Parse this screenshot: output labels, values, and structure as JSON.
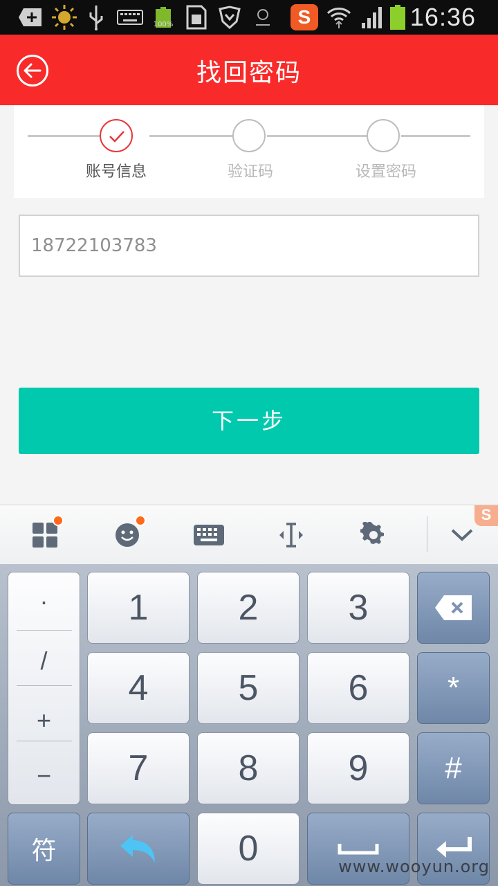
{
  "status_bar": {
    "time": "16:36",
    "battery_text": "100%",
    "sogou_badge": "S",
    "icons": [
      "plus-icon",
      "brightness-icon",
      "usb-icon",
      "keyboard-icon",
      "battery-full-icon",
      "sd-card-icon",
      "shield-icon",
      "emblem-icon",
      "sogou-icon",
      "wifi-icon",
      "signal-icon",
      "battery-icon"
    ]
  },
  "header": {
    "title": "找回密码",
    "background": "#f92a2a"
  },
  "steps": [
    {
      "label": "账号信息",
      "state": "done"
    },
    {
      "label": "验证码",
      "state": "pending"
    },
    {
      "label": "设置密码",
      "state": "pending"
    }
  ],
  "form": {
    "phone_value": "18722103783"
  },
  "next_button": {
    "label": "下一步",
    "color": "#00c9ae"
  },
  "keyboard": {
    "toolbar_icons": [
      "apps-icon",
      "emoji-icon",
      "keyboard-icon",
      "cursor-icon",
      "settings-icon",
      "collapse-icon"
    ],
    "brand_logo": "S",
    "symbols": [
      "·",
      "/",
      "+",
      "−"
    ],
    "digits": [
      "1",
      "2",
      "3",
      "4",
      "5",
      "6",
      "7",
      "8",
      "9",
      "0"
    ],
    "right_keys": [
      "*",
      "#"
    ],
    "symbol_switch": "符"
  },
  "watermark": "www.wooyun.org"
}
